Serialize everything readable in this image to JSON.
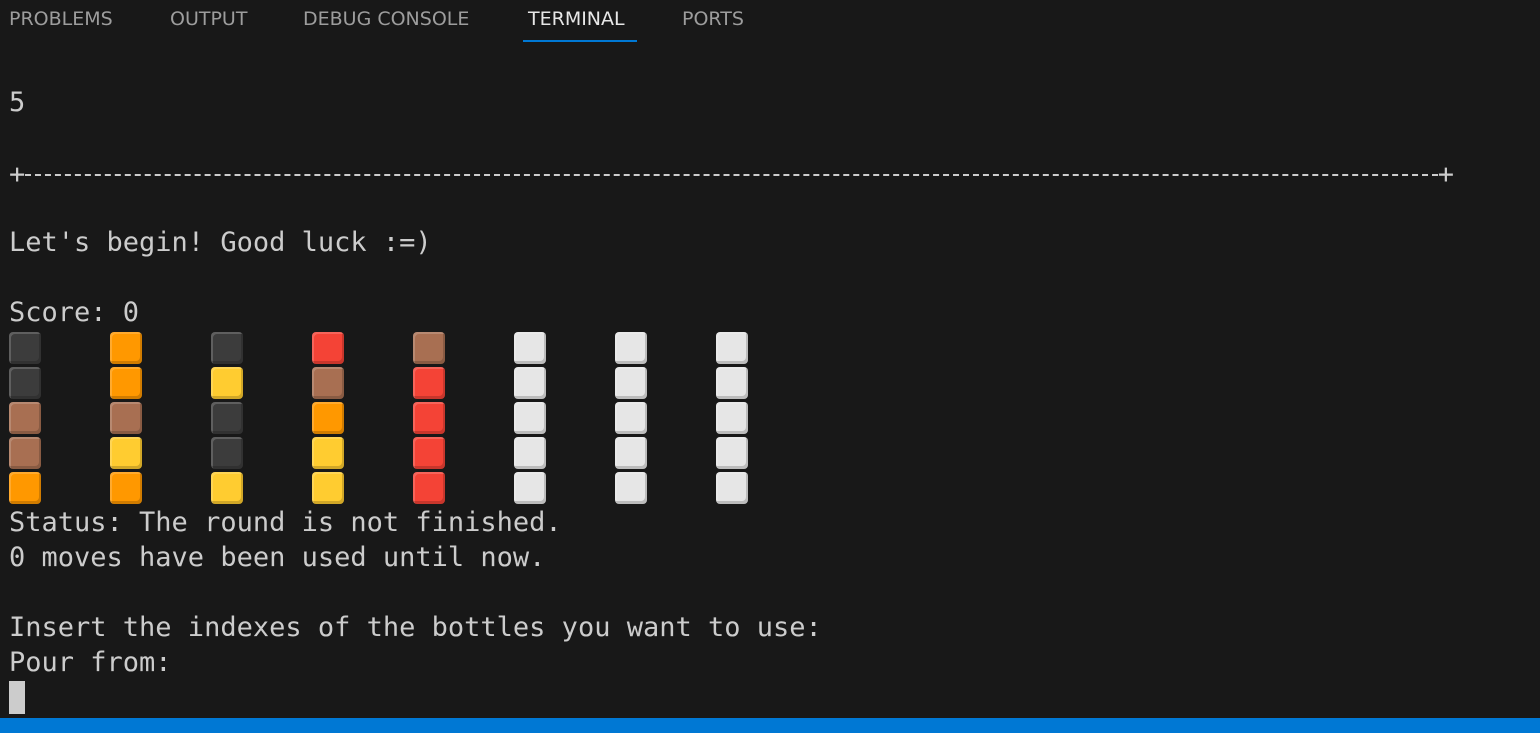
{
  "panel": {
    "tabs": [
      {
        "label": "PROBLEMS",
        "active": false
      },
      {
        "label": "OUTPUT",
        "active": false
      },
      {
        "label": "DEBUG CONSOLE",
        "active": false
      },
      {
        "label": "TERMINAL",
        "active": true
      },
      {
        "label": "PORTS",
        "active": false
      }
    ],
    "accent_color": "#0078d4"
  },
  "terminal": {
    "line_number_prompt": "5",
    "divider_left": "+",
    "divider_right": "+",
    "welcome": "Let's begin! Good luck :=)",
    "score_line": "Score: 0",
    "status_line": "Status: The round is not finished.",
    "moves_line": "0 moves have been used until now.",
    "insert_prompt": "Insert the indexes of the bottles you want to use:",
    "pour_from_prompt": "Pour from:"
  },
  "game": {
    "palette": {
      "black": "#3c3c3c",
      "orange": "#ff9800",
      "red": "#f44336",
      "brown": "#a86f52",
      "yellow": "#ffcc30",
      "white": "#e6e6e6"
    },
    "rows": [
      [
        "black",
        "orange",
        "black",
        "red",
        "brown",
        "white",
        "white",
        "white"
      ],
      [
        "black",
        "orange",
        "yellow",
        "brown",
        "red",
        "white",
        "white",
        "white"
      ],
      [
        "brown",
        "brown",
        "black",
        "orange",
        "red",
        "white",
        "white",
        "white"
      ],
      [
        "brown",
        "yellow",
        "black",
        "yellow",
        "red",
        "white",
        "white",
        "white"
      ],
      [
        "orange",
        "orange",
        "yellow",
        "yellow",
        "red",
        "white",
        "white",
        "white"
      ]
    ]
  }
}
